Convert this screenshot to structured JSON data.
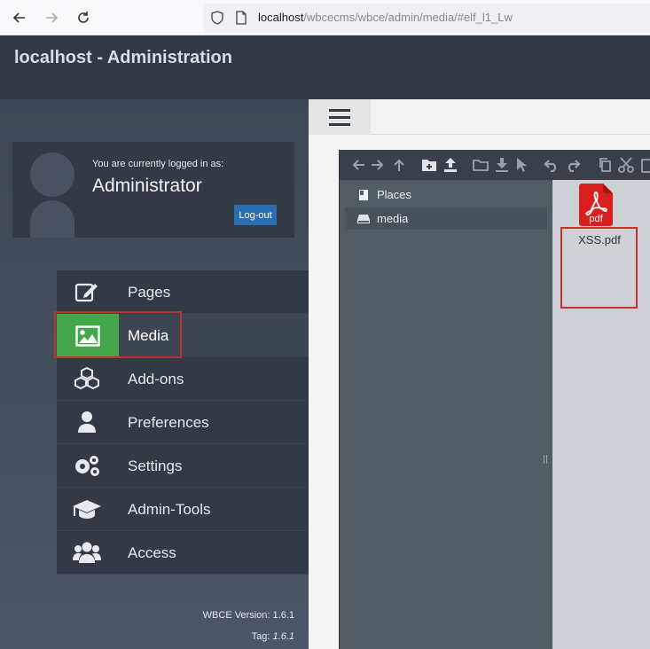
{
  "browser": {
    "url_host": "localhost",
    "url_path": "/wbcecms/wbce/admin/media/#elf_l1_Lw"
  },
  "header": {
    "title": "localhost - Administration"
  },
  "user_box": {
    "logged_in_label": "You are currently logged in as:",
    "user_name": "Administrator",
    "logout_label": "Log-out"
  },
  "menu": {
    "items": [
      {
        "label": "Pages",
        "icon": "edit-icon"
      },
      {
        "label": "Media",
        "icon": "image-icon",
        "active": true
      },
      {
        "label": "Add-ons",
        "icon": "cubes-icon"
      },
      {
        "label": "Preferences",
        "icon": "user-icon"
      },
      {
        "label": "Settings",
        "icon": "gears-icon"
      },
      {
        "label": "Admin-Tools",
        "icon": "graduation-cap-icon"
      },
      {
        "label": "Access",
        "icon": "users-icon"
      }
    ]
  },
  "footer": {
    "version": "WBCE Version: 1.6.1",
    "tag_label": "Tag:",
    "tag_value": "1.6.1"
  },
  "file_manager": {
    "places_label": "Places",
    "media_label": "media",
    "files": [
      {
        "name": "XSS.pdf",
        "type_label": "pdf"
      }
    ]
  },
  "colors": {
    "header_bg": "#333945",
    "active_green": "#44a84a",
    "logout_blue": "#2a6db0",
    "highlight_red": "#c0332b",
    "pdf_red": "#d9201c"
  }
}
